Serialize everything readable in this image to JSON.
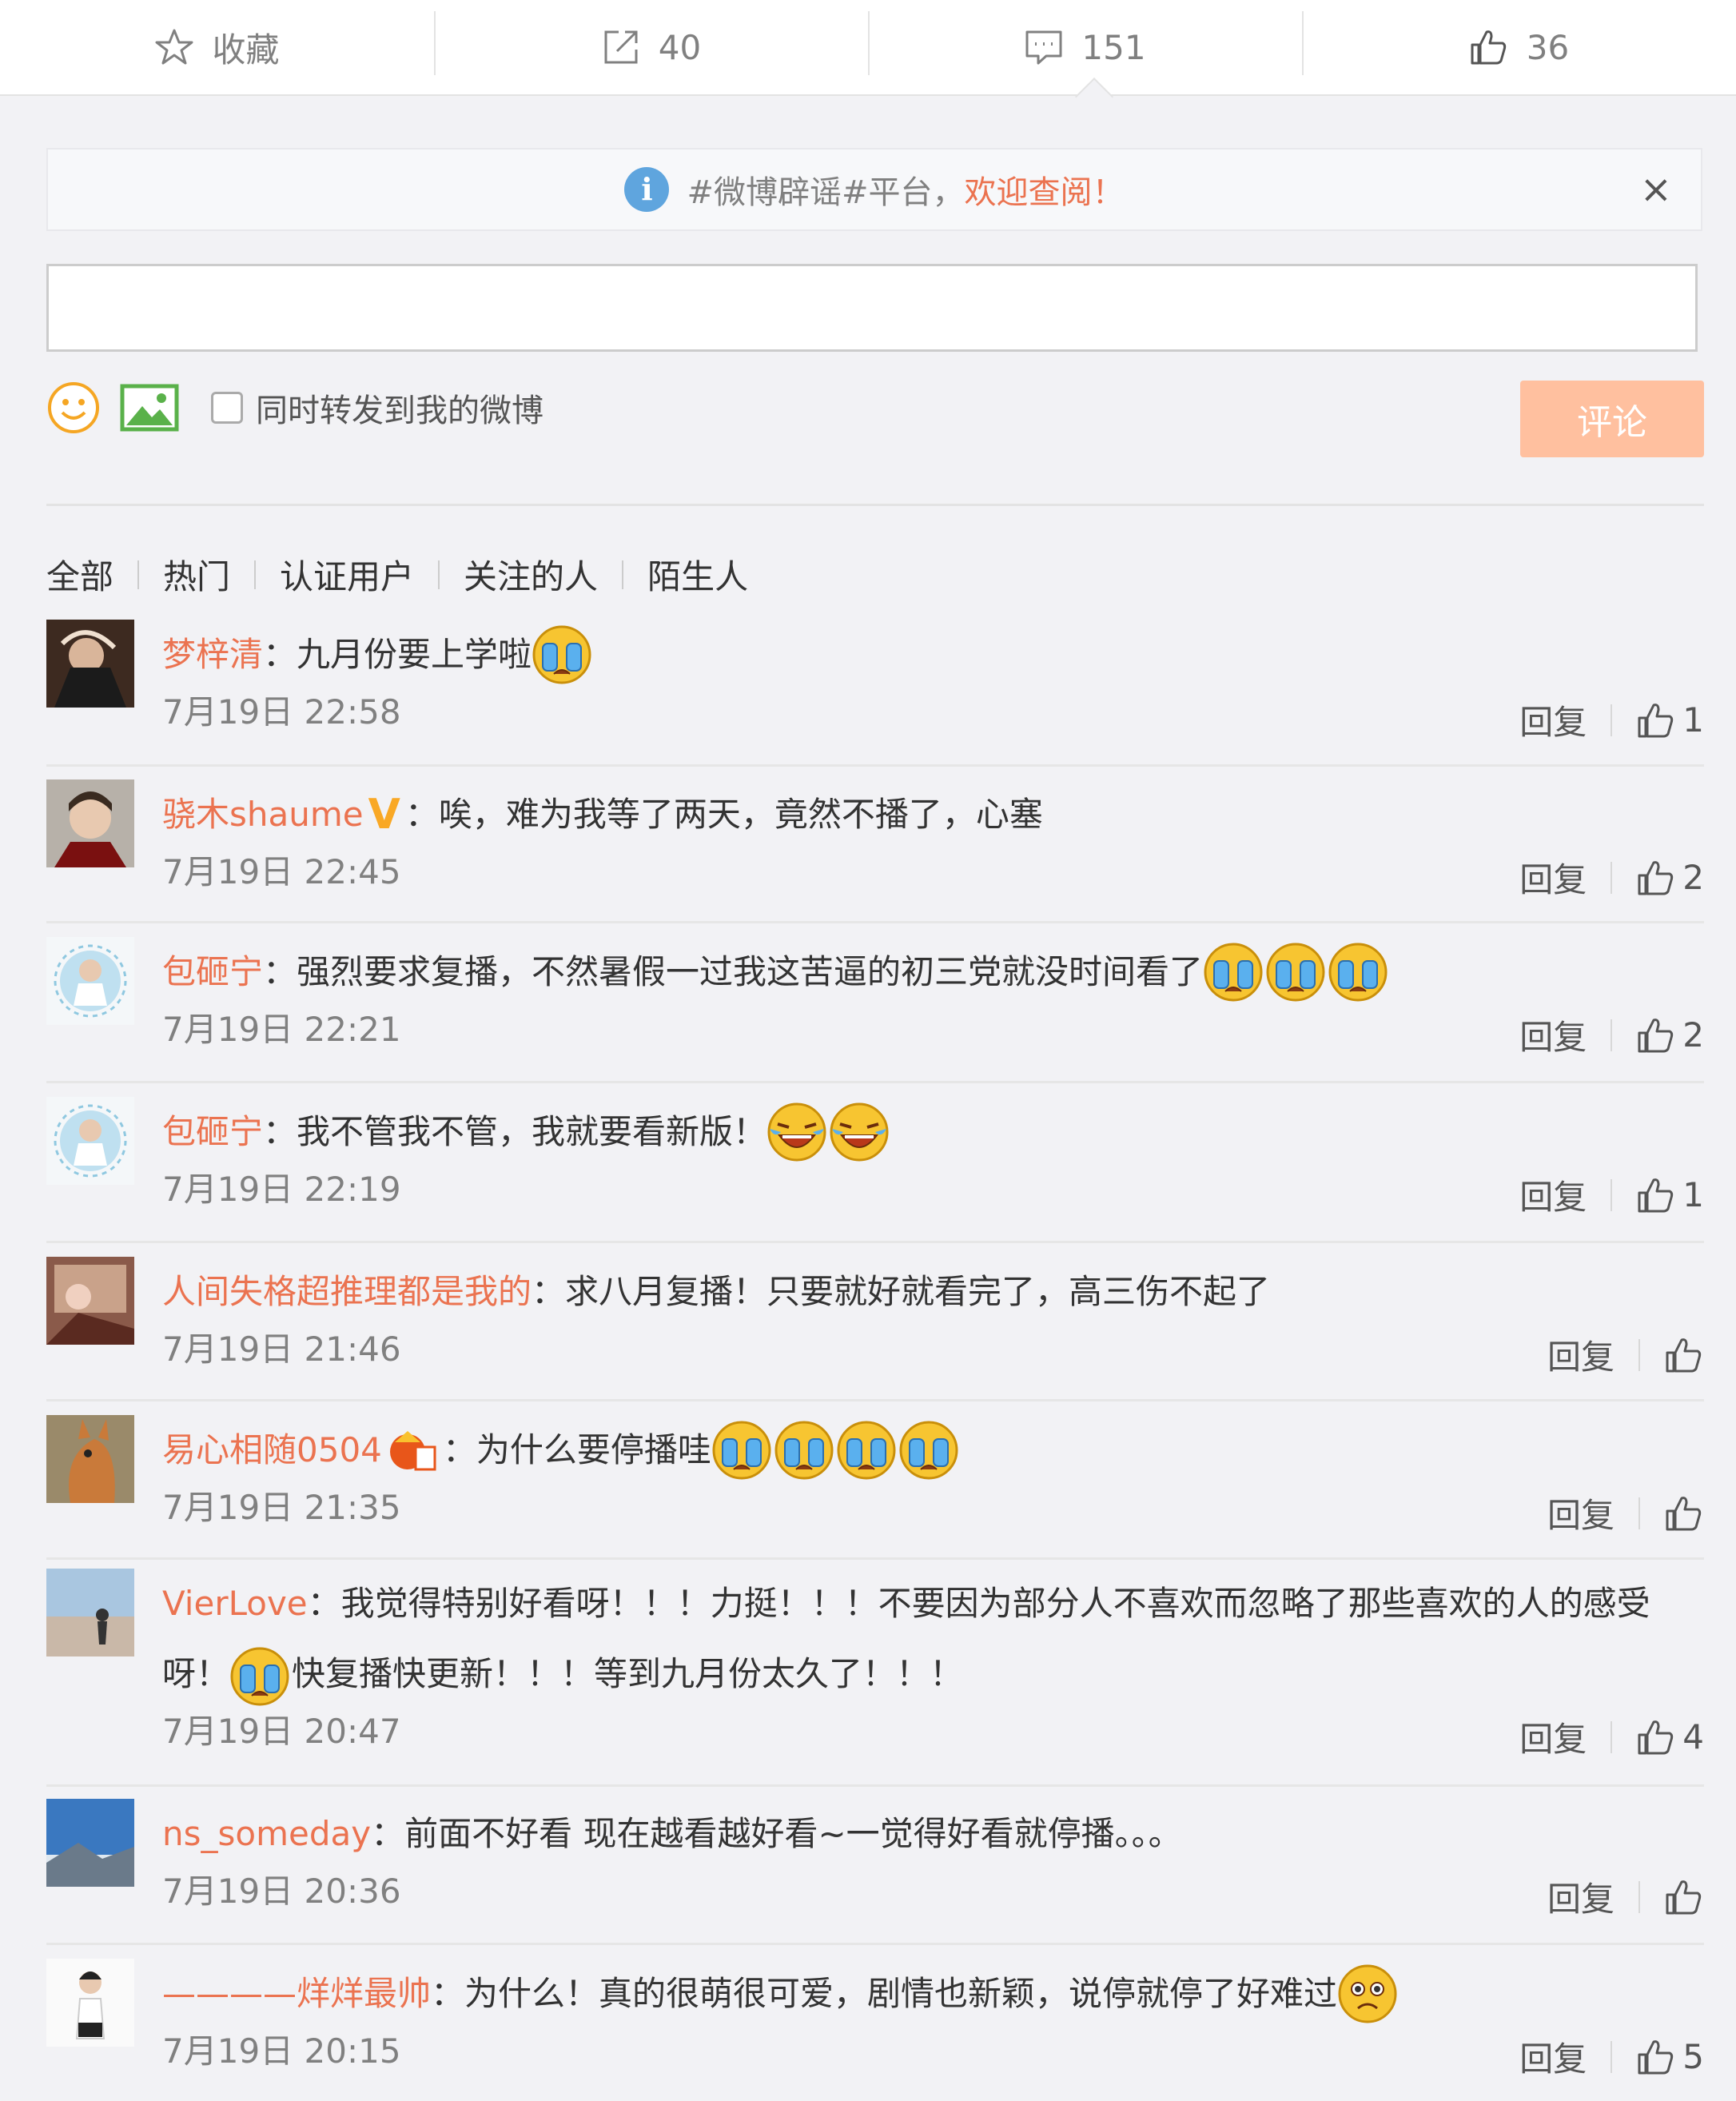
{
  "actions": {
    "favorite": "收藏",
    "forward_count": "40",
    "comment_count": "151",
    "like_count": "36"
  },
  "notice": {
    "text": "#微博辟谣#平台，",
    "highlight": "欢迎查阅！",
    "close": "×"
  },
  "composer": {
    "input_value": "",
    "forward_label": "同时转发到我的微博",
    "submit": "评论"
  },
  "filters": [
    "全部",
    "热门",
    "认证用户",
    "关注的人",
    "陌生人"
  ],
  "reply_label": "回复",
  "comments": [
    {
      "name": "梦梓清",
      "text": "：九月份要上学啦",
      "time": "7月19日 22:58",
      "likes": "1"
    },
    {
      "name": "骁木shaume",
      "badge": "V",
      "text": "：唉，难为我等了两天，竟然不播了，心塞",
      "time": "7月19日 22:45",
      "likes": "2"
    },
    {
      "name": "包砸宁",
      "text": "：强烈要求复播，不然暑假一过我这苦逼的初三党就没时间看了",
      "time": "7月19日 22:21",
      "likes": "2"
    },
    {
      "name": "包砸宁",
      "text": "：我不管我不管，我就要看新版！",
      "time": "7月19日 22:19",
      "likes": "1"
    },
    {
      "name": "人间失格超推理都是我的",
      "text": "：求八月复播！只要就好就看完了，高三伤不起了",
      "time": "7月19日 21:46",
      "likes": ""
    },
    {
      "name": "易心相随0504",
      "text": "：为什么要停播哇",
      "time": "7月19日 21:35",
      "likes": ""
    },
    {
      "name": "VierLove",
      "text": "：我觉得特别好看呀！！！力挺！！！不要因为部分人不喜欢而忽略了那些喜欢的人的感受呀！",
      "text2": "快复播快更新！！！等到九月份太久了！！！",
      "time": "7月19日 20:47",
      "likes": "4"
    },
    {
      "name": "ns_someday",
      "text": "：前面不好看 现在越看越好看~一觉得好看就停播。。。",
      "time": "7月19日 20:36",
      "likes": ""
    },
    {
      "name": "————烊烊最帅",
      "text": "：为什么！真的很萌很可爱，剧情也新颖，说停就停了好难过",
      "time": "7月19日 20:15",
      "likes": "5"
    }
  ],
  "icons": {
    "favorite": "star-outline-icon",
    "forward": "share-icon",
    "comment": "comment-icon",
    "like": "thumbs-up-icon",
    "info": "info-icon",
    "emoji": "smile-icon",
    "picture": "picture-icon"
  },
  "colors": {
    "accent": "#eb7350",
    "submit_disabled": "#ffc09f",
    "info": "#5fa5de"
  }
}
